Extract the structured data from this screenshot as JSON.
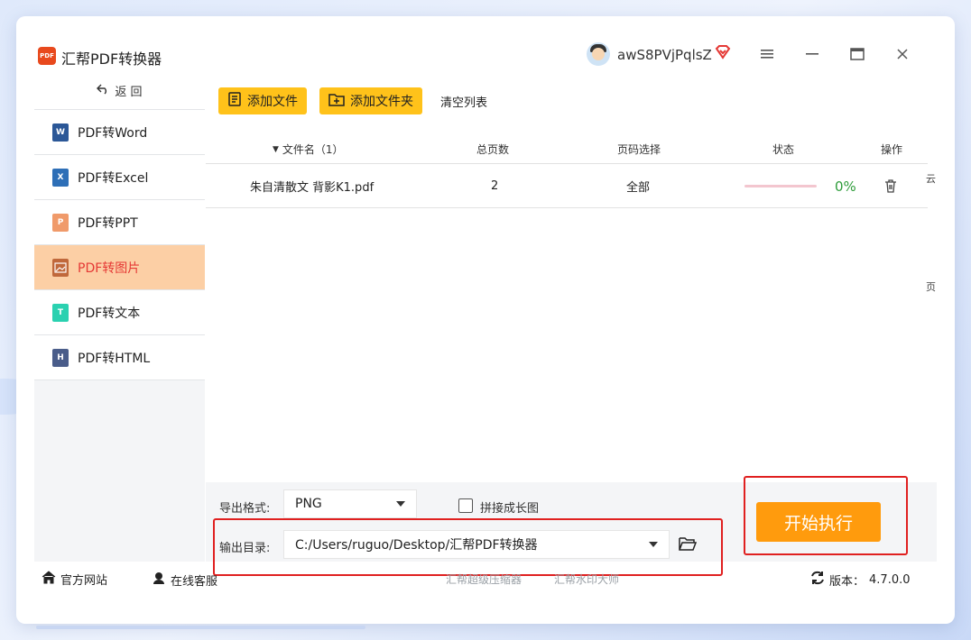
{
  "app": {
    "title": "汇帮PDF转换器",
    "logo_text": "PDF",
    "username": "awS8PVjPqlsZ",
    "window_controls": [
      "menu-icon",
      "minimize-icon",
      "maximize-icon",
      "close-icon"
    ]
  },
  "sidebar": {
    "back_label": "返  回",
    "items": [
      {
        "label": "PDF转Word",
        "icon": "word-icon",
        "color": "#2b5797",
        "active": false
      },
      {
        "label": "PDF转Excel",
        "icon": "excel-icon",
        "color": "#1e7145",
        "active": false
      },
      {
        "label": "PDF转PPT",
        "icon": "ppt-icon",
        "color": "#e8743b",
        "active": false
      },
      {
        "label": "PDF转图片",
        "icon": "image-icon",
        "color": "#c0392b",
        "active": true
      },
      {
        "label": "PDF转文本",
        "icon": "text-icon",
        "color": "#1abc9c",
        "active": false
      },
      {
        "label": "PDF转HTML",
        "icon": "html-icon",
        "color": "#34495e",
        "active": false
      }
    ]
  },
  "toolbar": {
    "add_file": "添加文件",
    "add_folder": "添加文件夹",
    "clear_list": "清空列表"
  },
  "table": {
    "headers": {
      "filename": "文件名（1）",
      "pages": "总页数",
      "page_select": "页码选择",
      "status": "状态",
      "action": "操作"
    },
    "rows": [
      {
        "filename": "朱自清散文    背影K1.pdf",
        "pages": "2",
        "page_select": "全部",
        "progress": 0,
        "percent": "0%"
      }
    ]
  },
  "right_scrap": {
    "top": "云",
    "bottom": "页"
  },
  "options": {
    "format_label": "导出格式:",
    "format_value": "PNG",
    "merge_label": "拼接成长图",
    "merge_checked": false,
    "output_label": "输出目录:",
    "output_value": "C:/Users/ruguo/Desktop/汇帮PDF转换器",
    "start_label": "开始执行"
  },
  "footer": {
    "website": "官方网站",
    "support": "在线客服",
    "link1": "汇帮超级压缩器",
    "link2": "汇帮水印大师",
    "version_label": "版本：",
    "version": "4.7.0.0"
  },
  "colors": {
    "accent_yellow": "#ffc21a",
    "start_orange": "#ff9b0d",
    "active_bg": "#fccfa5",
    "active_text": "#e53935",
    "progress_text": "#2e9c3a",
    "highlight_red": "#e02020"
  }
}
